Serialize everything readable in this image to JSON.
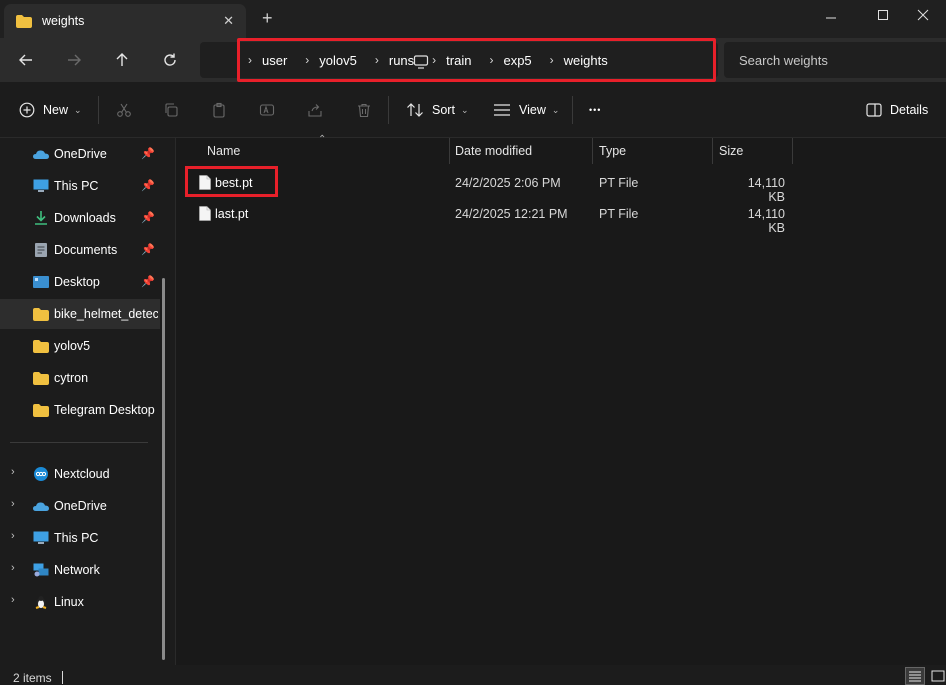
{
  "window": {
    "tab_title": "weights",
    "close_tab_glyph": "✕",
    "new_tab_glyph": "+"
  },
  "address": {
    "breadcrumbs": [
      "user",
      "yolov5",
      "runs",
      "train",
      "exp5",
      "weights"
    ],
    "search_placeholder": "Search weights"
  },
  "toolbar": {
    "new_label": "New",
    "sort_label": "Sort",
    "view_label": "View",
    "more_glyph": "•••",
    "details_label": "Details"
  },
  "sidebar": {
    "quick_access": [
      {
        "label": "OneDrive",
        "icon": "onedrive-icon",
        "pinned": true
      },
      {
        "label": "This PC",
        "icon": "pc-icon",
        "pinned": true
      },
      {
        "label": "Downloads",
        "icon": "download-icon",
        "pinned": true
      },
      {
        "label": "Documents",
        "icon": "document-icon",
        "pinned": true
      },
      {
        "label": "Desktop",
        "icon": "desktop-icon",
        "pinned": true
      },
      {
        "label": "bike_helmet_detect",
        "icon": "folder-icon",
        "pinned": false,
        "selected": true
      },
      {
        "label": "yolov5",
        "icon": "folder-icon",
        "pinned": false
      },
      {
        "label": "cytron",
        "icon": "folder-icon",
        "pinned": false
      },
      {
        "label": "Telegram Desktop",
        "icon": "folder-icon",
        "pinned": false
      }
    ],
    "locations": [
      {
        "label": "Nextcloud",
        "icon": "nextcloud-icon"
      },
      {
        "label": "OneDrive",
        "icon": "onedrive-icon"
      },
      {
        "label": "This PC",
        "icon": "pc-icon"
      },
      {
        "label": "Network",
        "icon": "network-icon"
      },
      {
        "label": "Linux",
        "icon": "linux-icon"
      }
    ]
  },
  "columns": {
    "name": "Name",
    "date": "Date modified",
    "type": "Type",
    "size": "Size"
  },
  "files": [
    {
      "name": "best.pt",
      "date": "24/2/2025 2:06 PM",
      "type": "PT File",
      "size": "14,110 KB"
    },
    {
      "name": "last.pt",
      "date": "24/2/2025 12:21 PM",
      "type": "PT File",
      "size": "14,110 KB"
    }
  ],
  "status": {
    "item_count": "2 items"
  },
  "colors": {
    "highlight": "#e8202a",
    "folder": "#f0c040",
    "accent_blue": "#4aa3df"
  }
}
